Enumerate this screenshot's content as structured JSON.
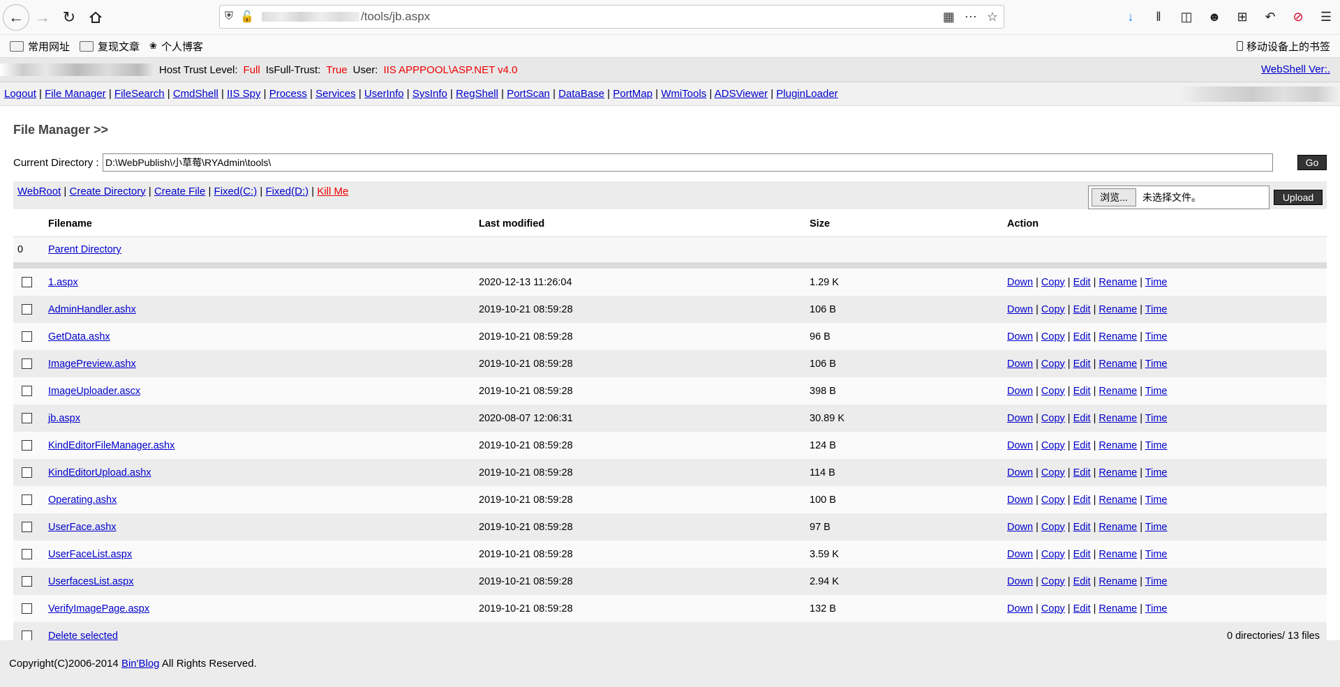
{
  "browser": {
    "url_tail": "/tools/jb.aspx",
    "bookmarks": [
      {
        "label": "常用网址",
        "icon": "folder-icon"
      },
      {
        "label": "复现文章",
        "icon": "folder-icon"
      },
      {
        "label": "个人博客",
        "icon": "blog-icon"
      }
    ],
    "mobile_bookmarks": "移动设备上的书签"
  },
  "infobar": {
    "host_trust_label": "Host Trust Level:",
    "host_trust_value": "Full",
    "full_trust_label": "IsFull-Trust:",
    "full_trust_value": "True",
    "user_label": "User:",
    "user_value": "IIS APPPOOL\\ASP.NET v4.0",
    "version_link": "WebShell Ver:."
  },
  "nav": [
    "Logout",
    "File Manager",
    "FileSearch",
    "CmdShell",
    "IIS Spy",
    "Process",
    "Services",
    "UserInfo",
    "SysInfo",
    "RegShell",
    "PortScan",
    "DataBase",
    "PortMap",
    "WmiTools",
    "ADSViewer",
    "PluginLoader"
  ],
  "page": {
    "title": "File Manager >>",
    "current_dir_label": "Current Directory :",
    "current_dir_value": "D:\\WebPublish\\小草莓\\RYAdmin\\tools\\",
    "go_label": "Go"
  },
  "actions": {
    "links": [
      "WebRoot",
      "Create Directory",
      "Create File",
      "Fixed(C:)",
      "Fixed(D:)"
    ],
    "kill_me": "Kill Me",
    "browse_label": "浏览...",
    "no_file": "未选择文件。",
    "upload_label": "Upload"
  },
  "table": {
    "headers": [
      "Filename",
      "Last modified",
      "Size",
      "Action"
    ],
    "parent_index": "0",
    "parent_label": "Parent Directory",
    "row_actions": [
      "Down",
      "Copy",
      "Edit",
      "Rename",
      "Time"
    ],
    "files": [
      {
        "name": "1.aspx",
        "modified": "2020-12-13 11:26:04",
        "size": "1.29 K"
      },
      {
        "name": "AdminHandler.ashx",
        "modified": "2019-10-21 08:59:28",
        "size": "106 B"
      },
      {
        "name": "GetData.ashx",
        "modified": "2019-10-21 08:59:28",
        "size": "96 B"
      },
      {
        "name": "ImagePreview.ashx",
        "modified": "2019-10-21 08:59:28",
        "size": "106 B"
      },
      {
        "name": "ImageUploader.ascx",
        "modified": "2019-10-21 08:59:28",
        "size": "398 B"
      },
      {
        "name": "jb.aspx",
        "modified": "2020-08-07 12:06:31",
        "size": "30.89 K"
      },
      {
        "name": "KindEditorFileManager.ashx",
        "modified": "2019-10-21 08:59:28",
        "size": "124 B"
      },
      {
        "name": "KindEditorUpload.ashx",
        "modified": "2019-10-21 08:59:28",
        "size": "114 B"
      },
      {
        "name": "Operating.ashx",
        "modified": "2019-10-21 08:59:28",
        "size": "100 B"
      },
      {
        "name": "UserFace.ashx",
        "modified": "2019-10-21 08:59:28",
        "size": "97 B"
      },
      {
        "name": "UserFaceList.aspx",
        "modified": "2019-10-21 08:59:28",
        "size": "3.59 K"
      },
      {
        "name": "UserfacesList.aspx",
        "modified": "2019-10-21 08:59:28",
        "size": "2.94 K"
      },
      {
        "name": "VerifyImagePage.aspx",
        "modified": "2019-10-21 08:59:28",
        "size": "132 B"
      }
    ],
    "delete_selected": "Delete selected",
    "summary": "0 directories/ 13 files"
  },
  "footer": {
    "copyright_prefix": "Copyright(C)2006-2014",
    "blog_link": "Bin'Blog",
    "copyright_suffix": "All Rights Reserved."
  }
}
